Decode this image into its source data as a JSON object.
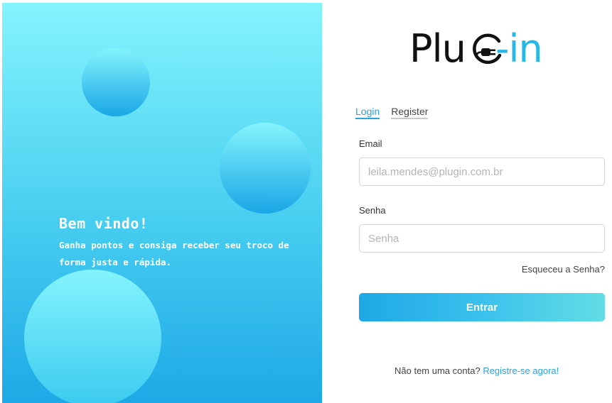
{
  "hero": {
    "title": "Bem vindo!",
    "text": "Ganha pontos e consiga receber seu troco de forma justa e rápida."
  },
  "logo": {
    "left_text": "Plu",
    "right_text": "-in",
    "icon": "plug-icon",
    "colors": {
      "dark": "#111111",
      "accent": "#27b8e8"
    }
  },
  "tabs": [
    {
      "label": "Login",
      "active": true
    },
    {
      "label": "Register",
      "active": false
    }
  ],
  "form": {
    "email_label": "Email",
    "email_placeholder": "leila.mendes@plugin.com.br",
    "password_label": "Senha",
    "password_placeholder": "Senha",
    "forgot_label": "Esqueceu a Senha?",
    "submit_label": "Entrar"
  },
  "signup": {
    "prompt": "Não tem uma conta?",
    "link": "Registre-se agora!"
  },
  "colors": {
    "accent": "#2aa2e0",
    "hero_top": "#84f4fd",
    "hero_bottom": "#1ea8e6"
  }
}
